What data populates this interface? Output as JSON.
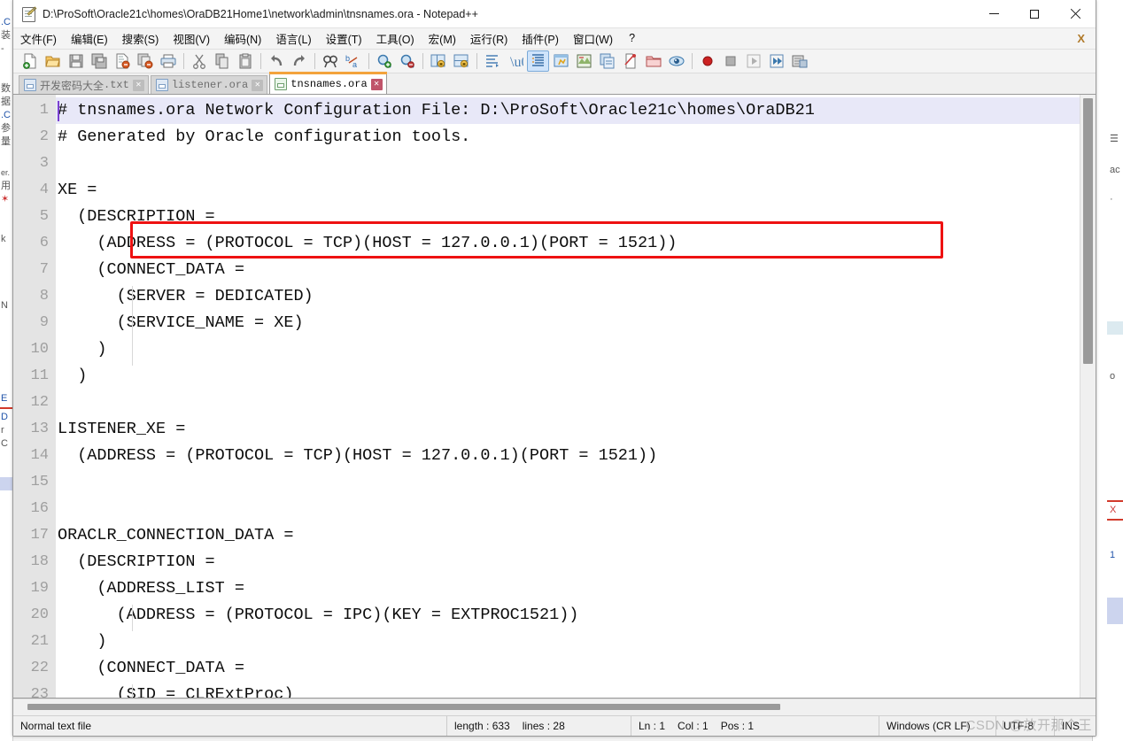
{
  "window": {
    "title": "D:\\ProSoft\\Oracle21c\\homes\\OraDB21Home1\\network\\admin\\tnsnames.ora - Notepad++",
    "app_icon": "notepad-plus-plus-icon",
    "minimize_label": "–",
    "maximize_label": "□",
    "close_label": "✕"
  },
  "menubar": {
    "items": [
      {
        "label": "文件(F)",
        "name": "menu-file"
      },
      {
        "label": "编辑(E)",
        "name": "menu-edit"
      },
      {
        "label": "搜索(S)",
        "name": "menu-search"
      },
      {
        "label": "视图(V)",
        "name": "menu-view"
      },
      {
        "label": "编码(N)",
        "name": "menu-encoding"
      },
      {
        "label": "语言(L)",
        "name": "menu-language"
      },
      {
        "label": "设置(T)",
        "name": "menu-settings"
      },
      {
        "label": "工具(O)",
        "name": "menu-tools"
      },
      {
        "label": "宏(M)",
        "name": "menu-macro"
      },
      {
        "label": "运行(R)",
        "name": "menu-run"
      },
      {
        "label": "插件(P)",
        "name": "menu-plugins"
      },
      {
        "label": "窗口(W)",
        "name": "menu-window"
      },
      {
        "label": "?",
        "name": "menu-help"
      }
    ],
    "doc_close_label": "X"
  },
  "toolbar": {
    "buttons": [
      {
        "name": "new-file-icon",
        "title": "新建"
      },
      {
        "name": "open-file-icon",
        "title": "打开"
      },
      {
        "name": "save-icon",
        "title": "保存"
      },
      {
        "name": "save-all-icon",
        "title": "全部保存"
      },
      {
        "name": "close-file-icon",
        "title": "关闭"
      },
      {
        "name": "close-all-icon",
        "title": "全部关闭"
      },
      {
        "name": "print-icon",
        "title": "打印"
      },
      {
        "sep": true
      },
      {
        "name": "cut-icon",
        "title": "剪切"
      },
      {
        "name": "copy-icon",
        "title": "复制"
      },
      {
        "name": "paste-icon",
        "title": "粘贴"
      },
      {
        "sep": true
      },
      {
        "name": "undo-icon",
        "title": "撤销"
      },
      {
        "name": "redo-icon",
        "title": "重做"
      },
      {
        "sep": true
      },
      {
        "name": "find-icon",
        "title": "查找"
      },
      {
        "name": "replace-icon",
        "title": "替换"
      },
      {
        "sep": true
      },
      {
        "name": "zoom-in-icon",
        "title": "放大"
      },
      {
        "name": "zoom-out-icon",
        "title": "缩小"
      },
      {
        "sep": true
      },
      {
        "name": "sync-vertical-scroll-icon",
        "title": "同步垂直滚动"
      },
      {
        "name": "sync-horizontal-scroll-icon",
        "title": "同步水平滚动"
      },
      {
        "sep": true
      },
      {
        "name": "word-wrap-icon",
        "title": "自动换行"
      },
      {
        "name": "show-all-chars-icon",
        "title": "显示所有字符"
      },
      {
        "name": "indent-guide-icon",
        "title": "缩进参考线",
        "active": true
      },
      {
        "name": "user-defined-dialog-icon",
        "title": "用户自定义"
      },
      {
        "name": "document-map-icon",
        "title": "文档地图"
      },
      {
        "name": "function-list-icon",
        "title": "函数列表"
      },
      {
        "name": "document-switcher-icon",
        "title": "文档切换器"
      },
      {
        "name": "folder-workspace-icon",
        "title": "文件浏览"
      },
      {
        "name": "monitoring-icon",
        "title": "监视"
      },
      {
        "sep": true
      },
      {
        "name": "record-macro-icon",
        "title": "开始录制宏"
      },
      {
        "name": "stop-macro-icon",
        "title": "停止录制宏"
      },
      {
        "name": "play-macro-icon",
        "title": "播放宏"
      },
      {
        "name": "run-macro-multiple-icon",
        "title": "多次运行宏"
      },
      {
        "name": "save-macro-icon",
        "title": "保存当前录制的宏"
      }
    ]
  },
  "tabs": [
    {
      "label": "开发密码大全",
      "ext": ".txt",
      "active": false,
      "name": "tab-dev-passwords",
      "close": "✕"
    },
    {
      "label": "listener",
      "ext": ".ora",
      "active": false,
      "name": "tab-listener-ora",
      "close": "✕"
    },
    {
      "label": "tnsnames",
      "ext": ".ora",
      "active": true,
      "name": "tab-tnsnames-ora",
      "close": "✕"
    }
  ],
  "editor": {
    "first_visible_line": 1,
    "lines": [
      {
        "n": 1,
        "text": "# tnsnames.ora Network Configuration File: D:\\ProSoft\\Oracle21c\\homes\\OraDB21",
        "current": true
      },
      {
        "n": 2,
        "text": "# Generated by Oracle configuration tools."
      },
      {
        "n": 3,
        "text": ""
      },
      {
        "n": 4,
        "text": "XE ="
      },
      {
        "n": 5,
        "text": "  (DESCRIPTION ="
      },
      {
        "n": 6,
        "text": "    (ADDRESS = (PROTOCOL = TCP)(HOST = 127.0.0.1)(PORT = 1521))",
        "highlighted": true
      },
      {
        "n": 7,
        "text": "    (CONNECT_DATA ="
      },
      {
        "n": 8,
        "text": "      (SERVER = DEDICATED)"
      },
      {
        "n": 9,
        "text": "      (SERVICE_NAME = XE)"
      },
      {
        "n": 10,
        "text": "    )"
      },
      {
        "n": 11,
        "text": "  )"
      },
      {
        "n": 12,
        "text": ""
      },
      {
        "n": 13,
        "text": "LISTENER_XE ="
      },
      {
        "n": 14,
        "text": "  (ADDRESS = (PROTOCOL = TCP)(HOST = 127.0.0.1)(PORT = 1521))"
      },
      {
        "n": 15,
        "text": ""
      },
      {
        "n": 16,
        "text": ""
      },
      {
        "n": 17,
        "text": "ORACLR_CONNECTION_DATA ="
      },
      {
        "n": 18,
        "text": "  (DESCRIPTION ="
      },
      {
        "n": 19,
        "text": "    (ADDRESS_LIST ="
      },
      {
        "n": 20,
        "text": "      (ADDRESS = (PROTOCOL = IPC)(KEY = EXTPROC1521))"
      },
      {
        "n": 21,
        "text": "    )"
      },
      {
        "n": 22,
        "text": "    (CONNECT_DATA ="
      },
      {
        "n": 23,
        "text": "      (SID = CLRExtProc)"
      }
    ],
    "annotation": {
      "name": "red-highlight-box",
      "color": "#ee1111",
      "target_line": 6
    }
  },
  "statusbar": {
    "file_type": "Normal text file",
    "length_label": "length : 633",
    "lines_label": "lines : 28",
    "ln": "Ln : 1",
    "col": "Col : 1",
    "pos": "Pos : 1",
    "eol": "Windows (CR LF)",
    "encoding": "UTF-8",
    "ins_mode": "INS"
  },
  "watermark": "CSDN @放开那个王",
  "background_windows": {
    "left_fragments": [
      ".C",
      "装",
      "-",
      "数",
      "据",
      ".C",
      "参",
      "量",
      "er.",
      "用",
      "★",
      "k",
      "N",
      "E",
      "D",
      "r",
      "C"
    ],
    "right_fragments": [
      "☰",
      "ac",
      ".",
      "o",
      "X",
      "1"
    ]
  },
  "colors": {
    "accent_tab": "#f3a33c",
    "annotation_red": "#ee1111",
    "current_line_bg": "#e8e8f8",
    "gutter_bg": "#e4e4e4",
    "caret": "#7a3fd0"
  }
}
